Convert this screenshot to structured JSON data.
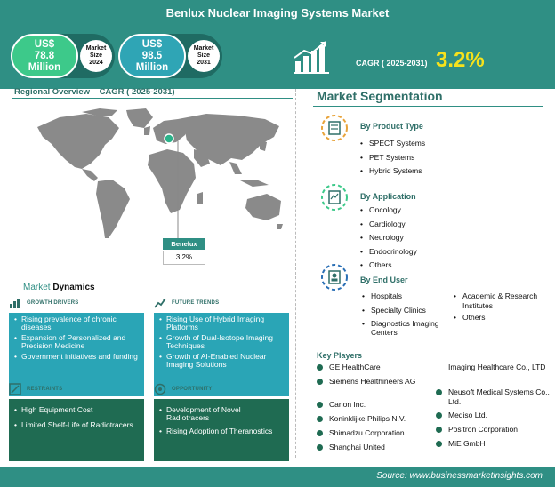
{
  "header": {
    "title": "Benlux Nuclear Imaging Systems Market",
    "size_2024": {
      "value": "US$ 78.8 Million",
      "l1": "US$",
      "l2": "78.8",
      "l3": "Million",
      "badge": [
        "Market",
        "Size",
        "2024"
      ]
    },
    "size_2031": {
      "value": "US$ 98.5 Million",
      "l1": "US$",
      "l2": "98.5",
      "l3": "Million",
      "badge": [
        "Market",
        "Size",
        "2031"
      ]
    },
    "cagr_label": "CAGR ( 2025-2031)",
    "cagr_value": "3.2%"
  },
  "regional": {
    "title": "Regional Overview – CAGR ( 2025-2031)",
    "region_name": "Benelux",
    "region_value": "3.2%"
  },
  "dynamics": {
    "title_a": "Market",
    "title_b": "Dynamics",
    "growth_drivers": {
      "heading": "GROWTH DRIVERS",
      "items": [
        "Rising prevalence of chronic diseases",
        "Expansion of Personalized and Precision Medicine",
        "Government initiatives and funding"
      ]
    },
    "future_trends": {
      "heading": "FUTURE TRENDS",
      "items": [
        "Rising Use of Hybrid Imaging Platforms",
        "Growth of Dual-Isotope Imaging Techniques",
        "Growth of AI-Enabled Nuclear Imaging Solutions"
      ]
    },
    "restraints": {
      "heading": "RESTRAINTS",
      "items": [
        "High Equipment Cost",
        "Limited Shelf-Life of Radiotracers"
      ]
    },
    "opportunity": {
      "heading": "OPPORTUNITY",
      "items": [
        "Development of Novel Radiotracers",
        "Rising Adoption of Theranostics"
      ]
    }
  },
  "segmentation": {
    "title": "Market Segmentation",
    "product_type": {
      "heading": "By Product Type",
      "items": [
        "SPECT Systems",
        "PET Systems",
        "Hybrid Systems"
      ]
    },
    "application": {
      "heading": "By Application",
      "items": [
        "Oncology",
        "Cardiology",
        "Neurology",
        "Endocrinology",
        "Others"
      ]
    },
    "end_user": {
      "heading": "By End User",
      "items_left": [
        "Hospitals",
        "Specialty Clinics",
        "Diagnostics Imaging Centers"
      ],
      "items_right": [
        "Academic & Research Institutes",
        "Others"
      ]
    }
  },
  "key_players": {
    "title": "Key Players",
    "left": [
      "GE HealthCare",
      "Siemens Healthineers AG",
      "Canon Inc.",
      "Koninklijke Philips N.V.",
      "Shimadzu Corporation",
      "Shanghai United"
    ],
    "right": [
      "Imaging Healthcare Co., LTD",
      "Neusoft Medical Systems Co., Ltd.",
      "Mediso Ltd.",
      "Positron Corporation",
      "MiE GmbH"
    ]
  },
  "footer": {
    "source": "Source: www.businessmarketinsights.com"
  },
  "colors": {
    "header": "#2f8f84",
    "teal_box": "#2aa5b6",
    "dark_box": "#1f6b52",
    "cagr_accent": "#f6e21c",
    "pill_green": "#3dc98a",
    "pill_teal": "#2fa5b5"
  }
}
